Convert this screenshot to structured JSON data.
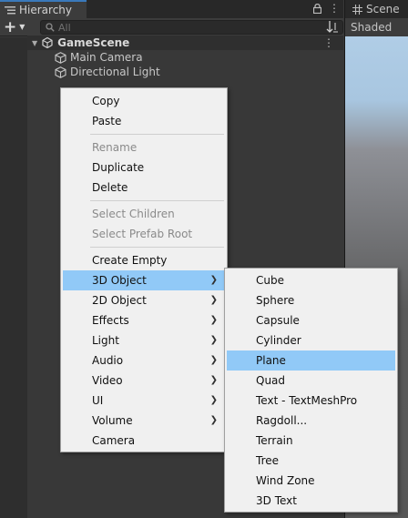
{
  "hierarchy": {
    "tab_label": "Hierarchy",
    "lock_icon": "lock-icon",
    "kebab": "⋮",
    "search_placeholder": "All",
    "scene_name": "GameScene",
    "objects": [
      {
        "name": "Main Camera",
        "icon": "cube-icon"
      },
      {
        "name": "Directional Light",
        "icon": "cube-icon"
      }
    ]
  },
  "scene_panel": {
    "tab_label": "Scene",
    "shading_label": "Shaded"
  },
  "context_menu": {
    "items": [
      {
        "label": "Copy",
        "enabled": true
      },
      {
        "label": "Paste",
        "enabled": true
      },
      {
        "label": "Rename",
        "enabled": false
      },
      {
        "label": "Duplicate",
        "enabled": true
      },
      {
        "label": "Delete",
        "enabled": true
      },
      {
        "label": "Select Children",
        "enabled": false
      },
      {
        "label": "Select Prefab Root",
        "enabled": false
      },
      {
        "label": "Create Empty",
        "enabled": true
      },
      {
        "label": "3D Object",
        "enabled": true,
        "submenu": true,
        "highlighted": true
      },
      {
        "label": "2D Object",
        "enabled": true,
        "submenu": true
      },
      {
        "label": "Effects",
        "enabled": true,
        "submenu": true
      },
      {
        "label": "Light",
        "enabled": true,
        "submenu": true
      },
      {
        "label": "Audio",
        "enabled": true,
        "submenu": true
      },
      {
        "label": "Video",
        "enabled": true,
        "submenu": true
      },
      {
        "label": "UI",
        "enabled": true,
        "submenu": true
      },
      {
        "label": "Volume",
        "enabled": true,
        "submenu": true
      },
      {
        "label": "Camera",
        "enabled": true
      }
    ]
  },
  "submenu_3d": {
    "items": [
      {
        "label": "Cube"
      },
      {
        "label": "Sphere"
      },
      {
        "label": "Capsule"
      },
      {
        "label": "Cylinder"
      },
      {
        "label": "Plane",
        "highlighted": true
      },
      {
        "label": "Quad"
      },
      {
        "label": "Text - TextMeshPro"
      },
      {
        "label": "Ragdoll..."
      },
      {
        "label": "Terrain"
      },
      {
        "label": "Tree"
      },
      {
        "label": "Wind Zone"
      },
      {
        "label": "3D Text"
      }
    ]
  },
  "colors": {
    "panel_bg": "#383838",
    "menu_bg": "#f0f0f0",
    "highlight": "#91c9f7",
    "tab_accent": "#3a79bb"
  }
}
